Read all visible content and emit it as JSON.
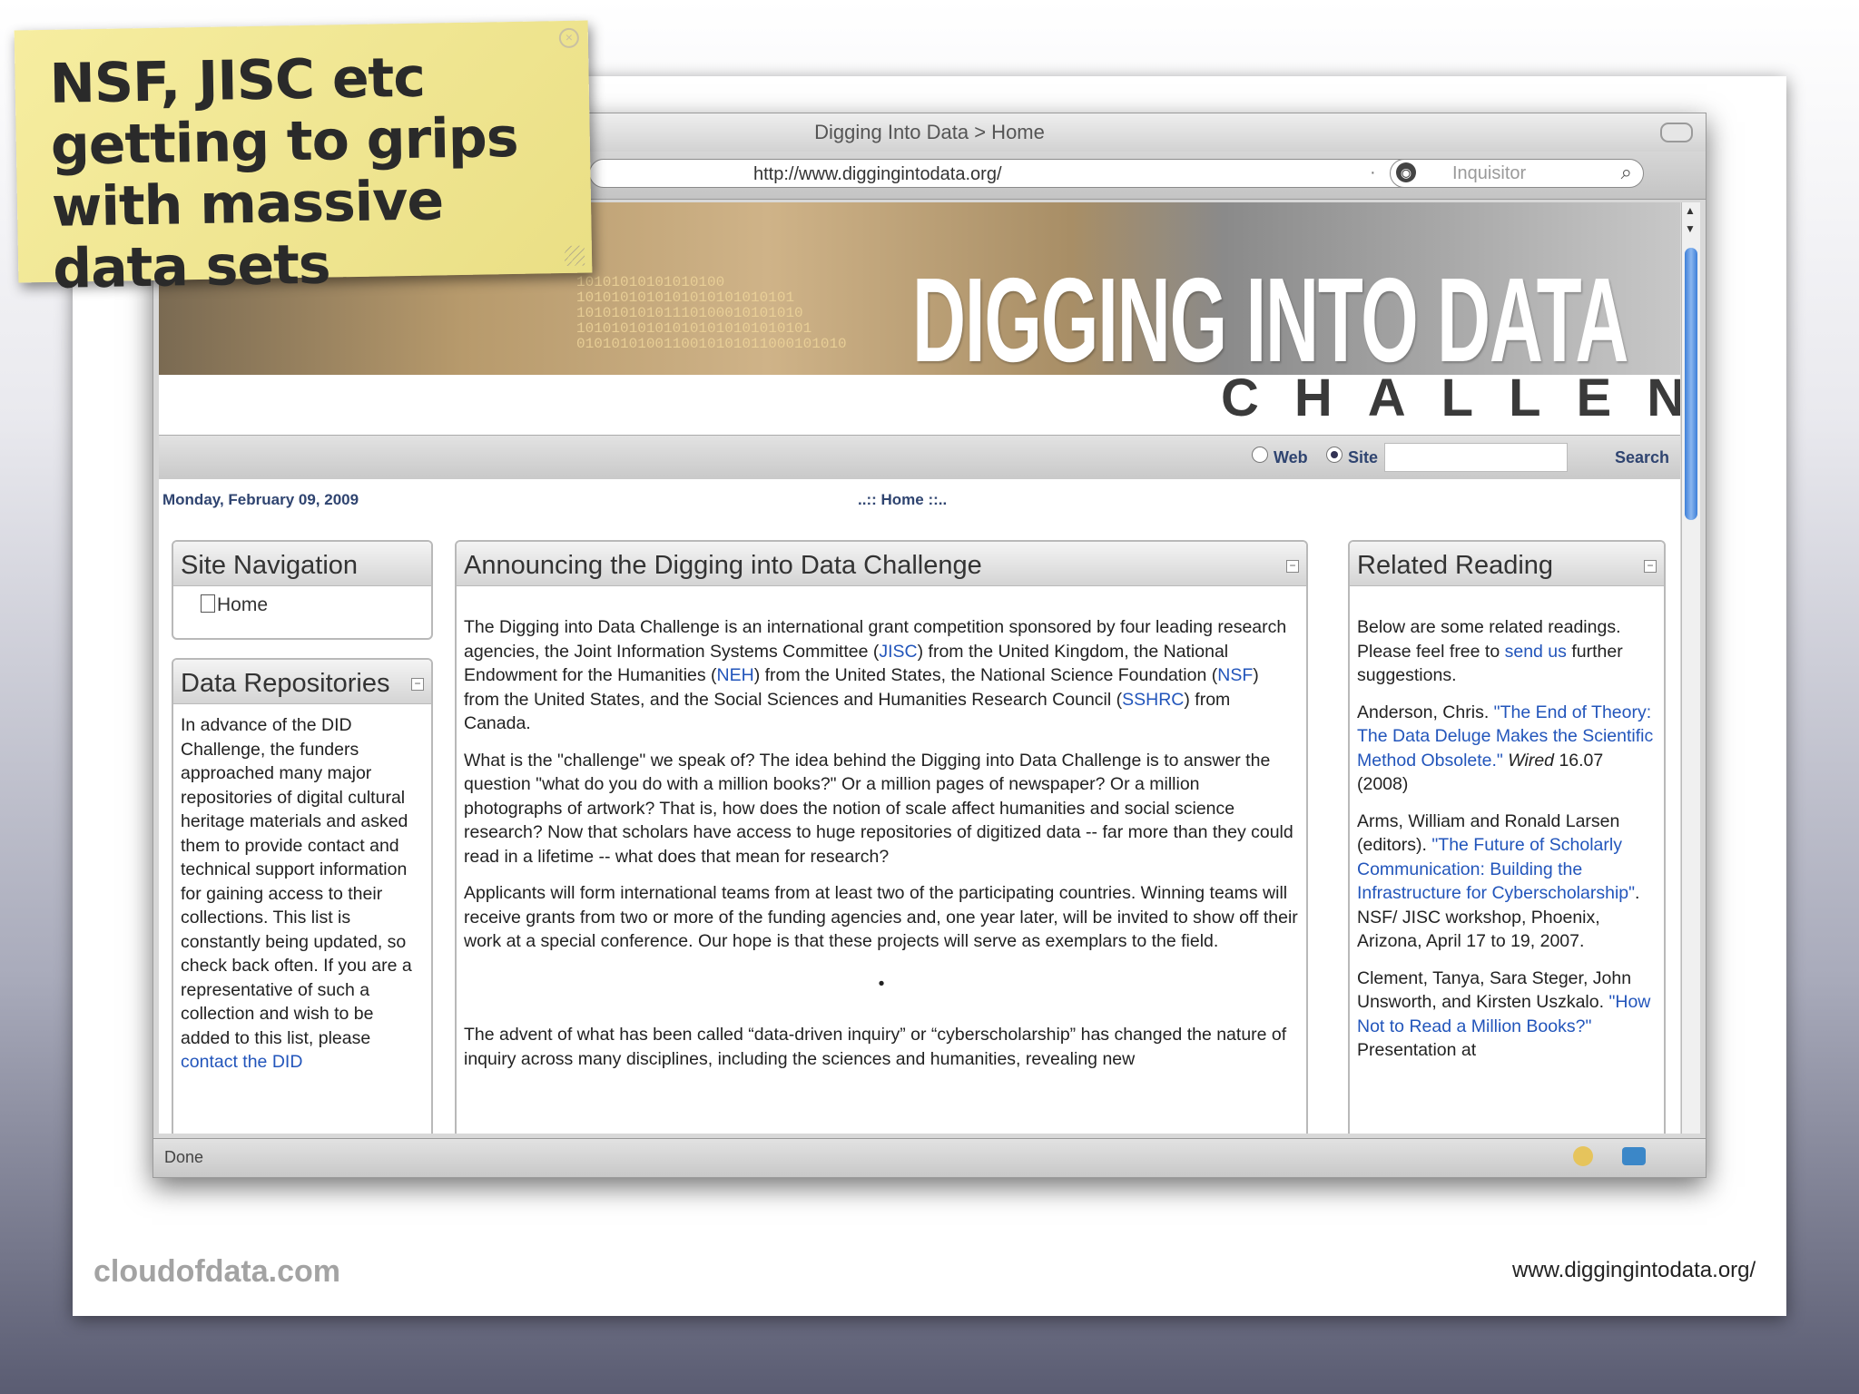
{
  "sticky_note": {
    "text": "NSF, JISC etc getting to grips with massive data sets"
  },
  "footer": {
    "left": "cloudofdata.com",
    "right": "www.diggingintodata.org/"
  },
  "browser": {
    "title": "Digging Into Data > Home",
    "url": "http://www.diggingintodata.org/",
    "search_placeholder": "Inquisitor",
    "status": "Done"
  },
  "site": {
    "banner_title": "DIGGING INTO DATA",
    "banner_subtitle": "CHALLENGE",
    "binary_text": "10101010101010100\n1010101010101010101010101\n10101010101110100010101010\n101010101010101010101010101\n0101010100110010101011000101010",
    "search_web_label": "Web",
    "search_site_label": "Site",
    "search_button": "Search",
    "date": "Monday, February 09, 2009",
    "home_crumb": "..:: Home ::.."
  },
  "nav_panel": {
    "title": "Site Navigation",
    "item": "Home"
  },
  "repos_panel": {
    "title": "Data Repositories",
    "body": "In advance of the DID Challenge, the funders approached many major repositories of digital cultural heritage materials and asked them to provide contact and technical support information for gaining access to their collections. This list is constantly being updated, so check back often. If you are a representative of such a collection and wish to be added to this list, please ",
    "link": "contact the DID"
  },
  "main_panel": {
    "title": "Announcing the Digging into Data Challenge",
    "p1_a": "The Digging into Data Challenge is an international grant competition sponsored by four leading research agencies, the Joint Information Systems Committee (",
    "jisc": "JISC",
    "p1_b": ") from the United Kingdom, the National Endowment for the Humanities (",
    "neh": "NEH",
    "p1_c": ") from the United States, the National Science Foundation (",
    "nsf": "NSF",
    "p1_d": ") from the United States, and the Social Sciences and Humanities Research Council (",
    "sshrc": "SSHRC",
    "p1_e": ") from Canada.",
    "p2": "What is the \"challenge\" we speak of? The idea behind the Digging into Data Challenge is to answer the question \"what do you do with a million books?\" Or a million pages of newspaper? Or a million photographs of artwork? That is, how does the notion of scale affect humanities and social science research? Now that scholars have access to huge repositories of digitized data -- far more than they could read in a lifetime -- what does that mean for research?",
    "p3": "Applicants will form international teams from at least two of the participating countries. Winning teams will receive grants from two or more of the funding agencies and, one year later, will be invited to show off their work at a special conference. Our hope is that these projects will serve as exemplars to the field.",
    "bullet": "•",
    "p4": "The advent of what has been called “data-driven inquiry” or “cyberscholarship” has changed the nature of inquiry across many disciplines, including the sciences and humanities, revealing new"
  },
  "reading_panel": {
    "title": "Related Reading",
    "intro_a": "Below are some related readings. Please feel free to ",
    "intro_link": "send us",
    "intro_b": " further suggestions.",
    "r1_a": "Anderson, Chris. ",
    "r1_link": "\"The End of Theory: The Data Deluge Makes the Scientific Method Obsolete.\"",
    "r1_journal": "Wired",
    "r1_b": " 16.07 (2008)",
    "r2_a": "Arms, William and Ronald Larsen (editors). ",
    "r2_link": "\"The Future of Scholarly Communication: Building the Infrastructure for Cyberscholarship\"",
    "r2_b": ". NSF/ JISC workshop, Phoenix, Arizona, April 17 to 19, 2007.",
    "r3_a": "Clement, Tanya, Sara Steger, John Unsworth, and Kirsten Uszkalo. ",
    "r3_link": "\"How Not to Read a Million Books?\"",
    "r3_b": " Presentation at"
  }
}
